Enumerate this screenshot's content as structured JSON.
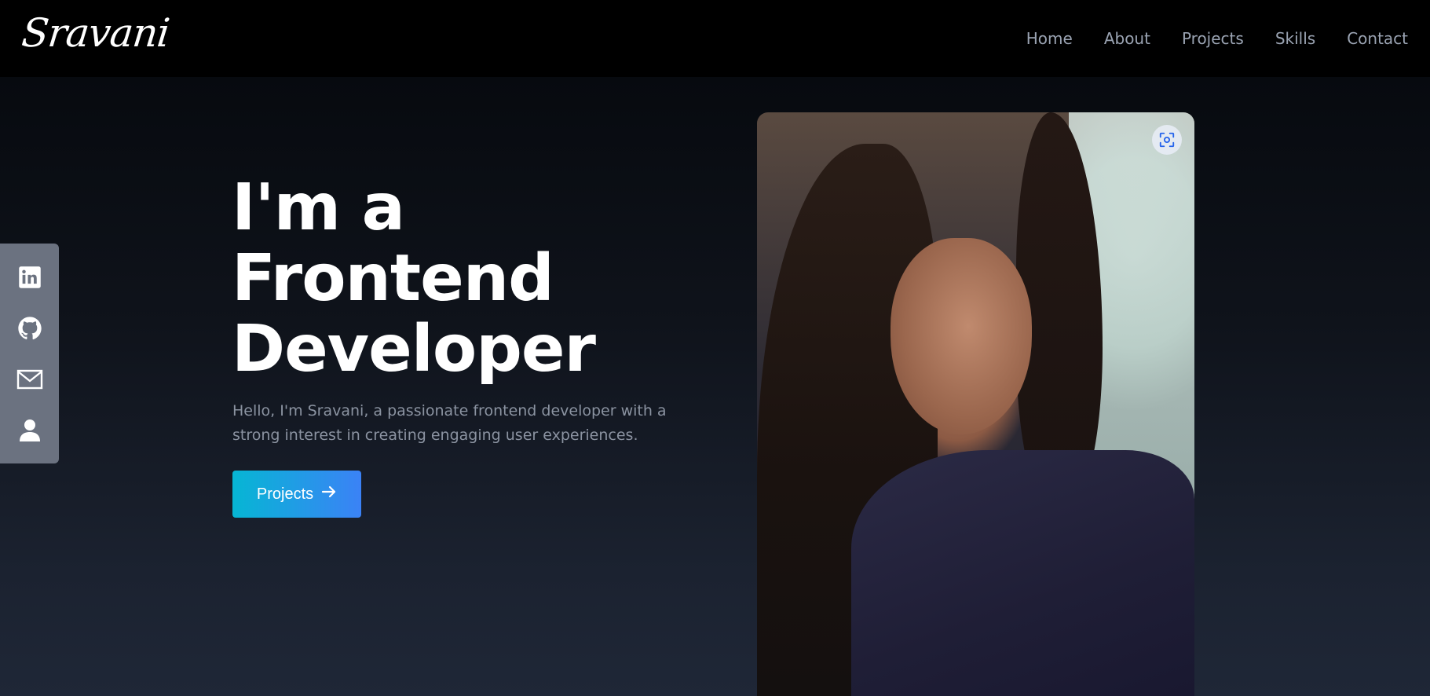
{
  "brand": {
    "logo_text": "Sravani"
  },
  "nav": {
    "items": [
      {
        "label": "Home"
      },
      {
        "label": "About"
      },
      {
        "label": "Projects"
      },
      {
        "label": "Skills"
      },
      {
        "label": "Contact"
      }
    ]
  },
  "social": {
    "icons": [
      "linkedin-icon",
      "github-icon",
      "mail-icon",
      "user-icon"
    ]
  },
  "hero": {
    "headline_line1": "I'm a",
    "headline_line2": "Frontend",
    "headline_line3": "Developer",
    "intro": "Hello, I'm Sravani, a passionate frontend developer with a strong interest in creating engaging user experiences.",
    "cta_label": "Projects",
    "cta_icon": "arrow-right-icon"
  },
  "photo": {
    "overlay_icon": "visual-search-icon"
  },
  "colors": {
    "background_top": "#070a0f",
    "background_bottom": "#1f2737",
    "nav_text": "#9aa3b2",
    "intro_text": "#8b93a1",
    "social_bar": "#6b7280",
    "cta_gradient_start": "#06b6d4",
    "cta_gradient_end": "#3b82f6"
  }
}
